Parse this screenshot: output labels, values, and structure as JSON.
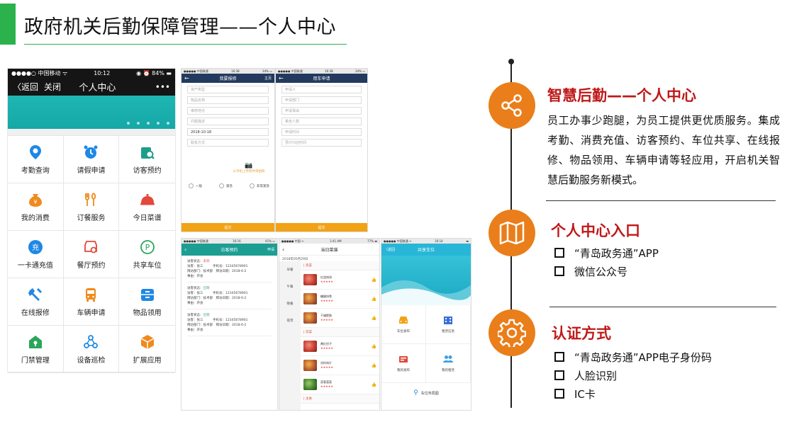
{
  "slide": {
    "title": "政府机关后勤保障管理——个人中心"
  },
  "phone1": {
    "status_left": "●●●●○ 中国移动 ᯤ",
    "status_time": "10:12",
    "status_right": "◉ ⏰ 84% ▬",
    "back_label": "〈返回",
    "close_label": "关闭",
    "title": "个人中心",
    "more": "•••",
    "grid": [
      {
        "label": "考勤查询",
        "icon": "location-pin-icon",
        "color": "#1e88e5"
      },
      {
        "label": "请假申请",
        "icon": "alarm-clock-icon",
        "color": "#1e88e5"
      },
      {
        "label": "访客预约",
        "icon": "visitor-search-icon",
        "color": "#1e9e8a"
      },
      {
        "label": "我的消费",
        "icon": "money-bag-icon",
        "color": "#f08a1c"
      },
      {
        "label": "订餐服务",
        "icon": "fork-knife-icon",
        "color": "#f08a1c"
      },
      {
        "label": "今日菜谱",
        "icon": "food-dome-icon",
        "color": "#e2483b"
      },
      {
        "label": "一卡通充值",
        "icon": "recharge-icon",
        "color": "#1e88e5"
      },
      {
        "label": "餐厅预约",
        "icon": "restaurant-gear-icon",
        "color": "#e2483b"
      },
      {
        "label": "共享车位",
        "icon": "parking-icon",
        "color": "#2aa65a"
      },
      {
        "label": "在线报修",
        "icon": "wrench-icon",
        "color": "#1e88e5"
      },
      {
        "label": "车辆申请",
        "icon": "bus-icon",
        "color": "#f08a1c"
      },
      {
        "label": "物品领用",
        "icon": "drawer-icon",
        "color": "#1e88e5"
      },
      {
        "label": "门禁管理",
        "icon": "door-lock-icon",
        "color": "#2aa65a"
      },
      {
        "label": "设备巡检",
        "icon": "devices-icon",
        "color": "#1e88e5"
      },
      {
        "label": "扩展应用",
        "icon": "cube-icon",
        "color": "#f08a1c"
      }
    ]
  },
  "repair": {
    "status_left": "●●●●● 中国联通",
    "status_time": "16:38",
    "status_right": "34% ▭",
    "title": "我要报修",
    "right": "主页",
    "fields": [
      "资产类型",
      "物品名称",
      "维修地点",
      "问题描述",
      "2018-10-18",
      "联系方式"
    ],
    "camera_hint": "从手机上传附件或拍照",
    "urgency": [
      "一般",
      "紧急",
      "非常紧急"
    ],
    "submit": "提交"
  },
  "vehicle": {
    "status_left": "●●●●● 中国联通",
    "status_time": "16:38",
    "status_right": "34% ▭",
    "title": "用车申请",
    "fields": [
      "申请人",
      "申请部门",
      "申请事由",
      "乘坐人数",
      "申请时间",
      "预计归还时间"
    ],
    "submit": "提交"
  },
  "visitor": {
    "status_left": "●●●●● 中国联通",
    "status_time": "16:16",
    "status_right": "41% ▭",
    "title": "访客预约",
    "right": "申请",
    "records": [
      {
        "status_label": "访客状态：",
        "status": "未到",
        "ok": false,
        "l1": "访客：张三　　　手机号：12345678901",
        "l2": "拜访部门：技术部　拜访日期：2018-6-2",
        "l3": "事由：开会"
      },
      {
        "status_label": "访客状态：",
        "status": "已到",
        "ok": true,
        "l1": "访客：张三　　　手机号：12345678901",
        "l2": "拜访部门：技术部　拜访日期：2018-6-2",
        "l3": "事由：开会"
      },
      {
        "status_label": "访客状态：",
        "status": "已到",
        "ok": true,
        "l1": "访客：张三　　　手机号：12345678901",
        "l2": "拜访部门：技术部　拜访日期：2018-6-2",
        "l3": "事由：开会"
      }
    ]
  },
  "menu": {
    "status_left": "●●●●● 中国 ᯤ",
    "status_time": "1:41 AM",
    "status_right": "77% ▬",
    "title": "当日菜谱",
    "date": "2018年05月29日",
    "side": [
      "早餐",
      "午餐",
      "晚餐",
      "夜宵"
    ],
    "categories": [
      {
        "name": "| 热菜",
        "dishes": [
          {
            "n": "红烧肉排",
            "p": "r"
          },
          {
            "n": "糖醋排骨",
            "p": "o"
          },
          {
            "n": "干煸肥肠",
            "p": "o"
          }
        ]
      },
      {
        "name": "| 凉菜",
        "dishes": [
          {
            "n": "酱红肘子",
            "p": "r"
          },
          {
            "n": "凉拌肉片",
            "p": "o"
          },
          {
            "n": "蒜蓉菠菜",
            "p": "g"
          }
        ]
      }
    ],
    "last_cat": "| 主食",
    "stars": "★★★★★",
    "like": "👍"
  },
  "parking": {
    "status_left": "●●●●● 中国联通 ᯤ",
    "status_time": "16:14",
    "status_right": "▬",
    "back": "〈返回",
    "title": "共享车位",
    "cells": [
      {
        "label": "车位发布",
        "icon": "car-icon",
        "color": "#f2a215"
      },
      {
        "label": "租赁信息",
        "icon": "building-icon",
        "color": "#3b6fd8"
      },
      {
        "label": "我的发布",
        "icon": "publish-icon",
        "color": "#e2483b"
      },
      {
        "label": "我的租赁",
        "icon": "users-icon",
        "color": "#3b9ee8"
      }
    ],
    "bottom": "车位布局图"
  },
  "sections": {
    "smart": {
      "title": "智慧后勤——个人中心",
      "body": "员工办事少跑腿，为员工提供更优质服务。集成考勤、消费充值、访客预约、车位共享、在线报修、物品领用、车辆申请等轻应用，开启机关智慧后勤服务新模式。"
    },
    "entry": {
      "title": "个人中心入口",
      "items": [
        "“青岛政务通”APP",
        "微信公众号"
      ]
    },
    "auth": {
      "title": "认证方式",
      "items": [
        "“青岛政务通”APP电子身份码",
        "人脸识别",
        "IC卡"
      ]
    }
  },
  "colors": {
    "accent_green": "#2bb24c",
    "accent_orange": "#ea7e1a",
    "title_red": "#c01818"
  }
}
